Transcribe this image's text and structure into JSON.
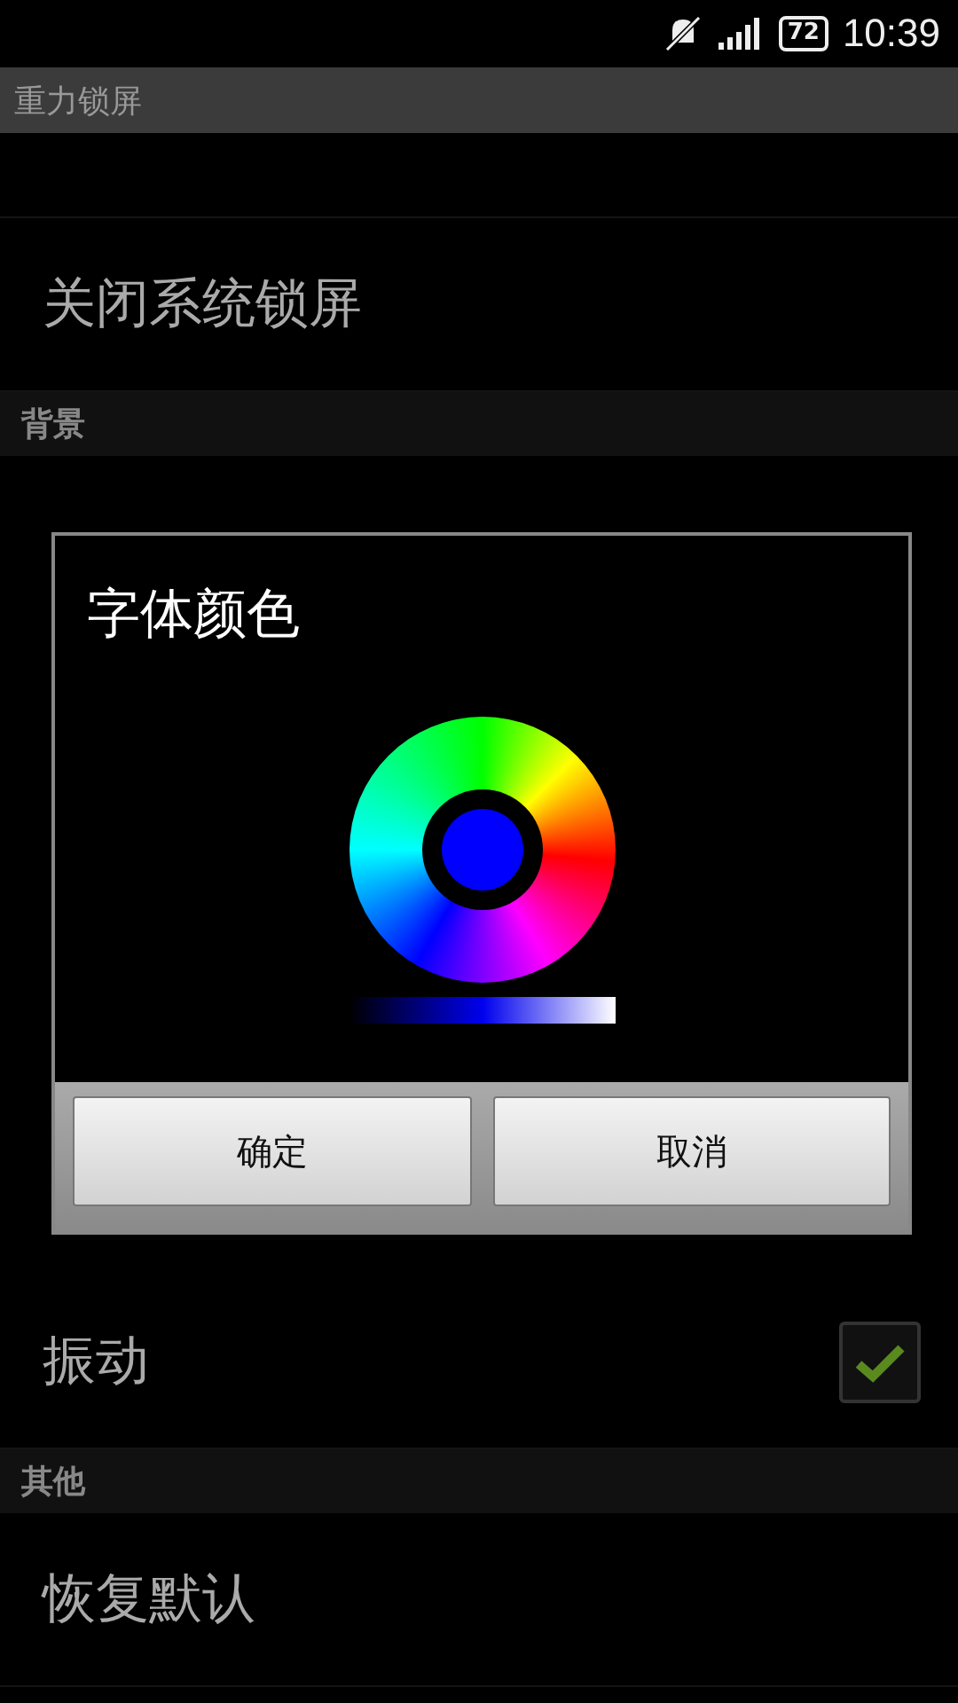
{
  "status_bar": {
    "battery": "72",
    "time": "10:39"
  },
  "list": [
    {
      "kind": "header",
      "label": "重力锁屏"
    },
    {
      "kind": "hidden"
    },
    {
      "kind": "item",
      "label": "关闭系统锁屏"
    },
    {
      "kind": "header",
      "label": "背景"
    },
    {
      "kind": "covered"
    },
    {
      "kind": "checkbox",
      "label": "振动",
      "checked": true
    },
    {
      "kind": "header",
      "label": "其他"
    },
    {
      "kind": "item",
      "label": "恢复默认"
    }
  ],
  "dialog": {
    "title": "字体颜色",
    "buttons": [
      "确定",
      "取消"
    ]
  }
}
